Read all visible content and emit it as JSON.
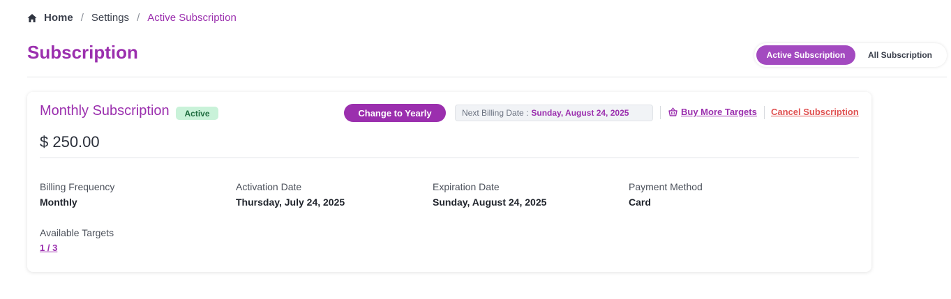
{
  "breadcrumb": {
    "home": "Home",
    "settings": "Settings",
    "current": "Active Subscription",
    "separator": "/"
  },
  "page": {
    "title": "Subscription"
  },
  "toggle": {
    "active_label": "Active Subscription",
    "all_label": "All Subscription",
    "selected": "Active Subscription"
  },
  "card": {
    "plan_name": "Monthly Subscription",
    "status": "Active",
    "change_button": "Change to Yearly",
    "next_billing_label": "Next Billing Date :",
    "next_billing_value": "Sunday, August 24, 2025",
    "buy_more": "Buy More Targets",
    "cancel": "Cancel Subscription",
    "price": "$ 250.00",
    "fields": {
      "billing_frequency": {
        "label": "Billing Frequency",
        "value": "Monthly"
      },
      "activation_date": {
        "label": "Activation Date",
        "value": "Thursday, July 24, 2025"
      },
      "expiration_date": {
        "label": "Expiration Date",
        "value": "Sunday, August 24, 2025"
      },
      "payment_method": {
        "label": "Payment Method",
        "value": "Card"
      },
      "available_targets": {
        "label": "Available Targets",
        "value": "1 / 3"
      }
    }
  },
  "colors": {
    "accent": "#9b2fae",
    "toggle_active": "#a34ac0",
    "danger": "#e05252",
    "badge_bg": "#c9f2d9"
  },
  "icons": {
    "home": "home-icon",
    "basket": "basket-icon"
  }
}
